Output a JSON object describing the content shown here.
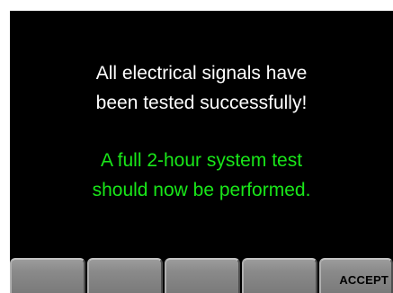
{
  "message": {
    "line1": "All electrical signals have",
    "line2": "been tested successfully!",
    "line3": "A full 2-hour system test",
    "line4": "should now be performed."
  },
  "softkeys": [
    {
      "label": ""
    },
    {
      "label": ""
    },
    {
      "label": ""
    },
    {
      "label": ""
    },
    {
      "label": "ACCEPT"
    }
  ],
  "colors": {
    "background": "#000000",
    "primary_text": "#ffffff",
    "highlight_text": "#19e619",
    "softkey": "#8a8a8a"
  }
}
